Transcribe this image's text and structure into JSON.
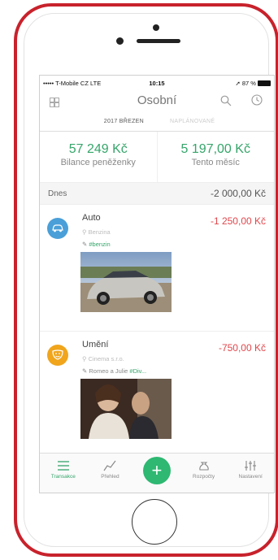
{
  "status_bar": {
    "carrier": "••••• T-Mobile CZ  LTE",
    "time": "10:15",
    "battery": "➚ 87 %"
  },
  "header": {
    "title": "Osobní"
  },
  "tabs": [
    {
      "label": "2017 BŘEZEN"
    },
    {
      "label": "NAPLÁNOVANÉ"
    }
  ],
  "summary": {
    "wallet_value": "57 249 Kč",
    "wallet_label": "Bilance peněženky",
    "month_value": "5 197,00 Kč",
    "month_label": "Tento měsíc"
  },
  "day": {
    "label": "Dnes",
    "total": "-2 000,00 Kč"
  },
  "transactions": [
    {
      "name": "Auto",
      "amount": "-1 250,00 Kč",
      "place": "Benzina",
      "tag_prefix": "",
      "tag": "#benzin",
      "color": "#4a9fd8",
      "icon": "car-icon"
    },
    {
      "name": "Umění",
      "amount": "-750,00 Kč",
      "place": "Cinema s.r.o.",
      "tag_prefix": "Romeo a Julie ",
      "tag": "#Div...",
      "color": "#f0a51c",
      "icon": "theater-masks-icon"
    }
  ],
  "bottom_nav": [
    {
      "label": "Transakce"
    },
    {
      "label": "Přehled"
    },
    {
      "label": "+"
    },
    {
      "label": "Rozpočty"
    },
    {
      "label": "Nastavení"
    }
  ],
  "colors": {
    "accent": "#35a56a",
    "expense": "#e0474c",
    "frame": "#c8222c"
  }
}
